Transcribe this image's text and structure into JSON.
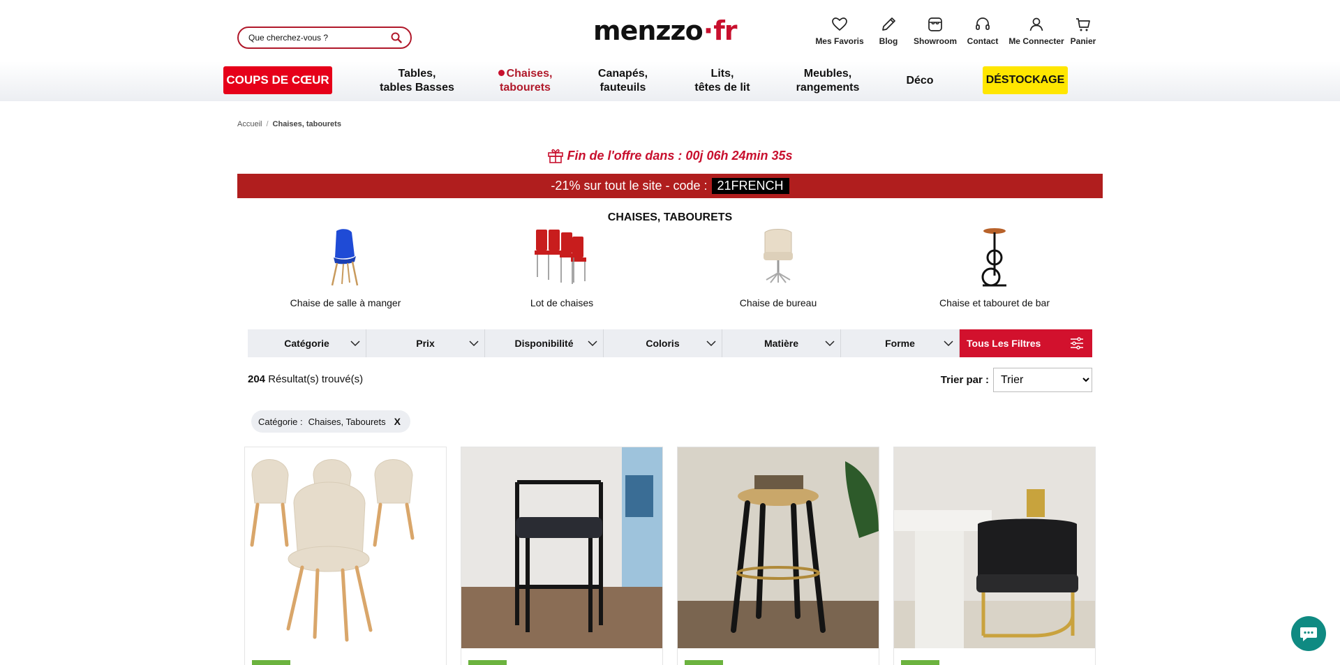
{
  "search": {
    "placeholder": "Que cherchez-vous ?"
  },
  "logo": {
    "part1": "menzzo",
    "dot": "·",
    "part2": "fr"
  },
  "header_icons": [
    {
      "icon": "heart-icon",
      "label": "Mes Favoris"
    },
    {
      "icon": "pencil-icon",
      "label": "Blog"
    },
    {
      "icon": "store-icon",
      "label": "Showroom"
    },
    {
      "icon": "headset-icon",
      "label": "Contact"
    },
    {
      "icon": "user-icon",
      "label": "Me Connecter"
    },
    {
      "icon": "cart-icon",
      "label": "Panier"
    }
  ],
  "nav": {
    "coups": "COUPS DE CŒUR",
    "tables": [
      "Tables,",
      "tables Basses"
    ],
    "chaises": [
      "Chaises,",
      "tabourets"
    ],
    "canapes": [
      "Canapés,",
      "fauteuils"
    ],
    "lits": [
      "Lits,",
      "têtes de lit"
    ],
    "meubles": [
      "Meubles,",
      "rangements"
    ],
    "deco": "Déco",
    "destockage": "DÉSTOCKAGE"
  },
  "breadcrumb": {
    "home": "Accueil",
    "sep": "/",
    "current": "Chaises, tabourets"
  },
  "offer": {
    "text": "Fin de l'offre dans : 00j 06h 24min 35s"
  },
  "promo": {
    "text": "-21% sur tout le site - code :",
    "code": "21FRENCH"
  },
  "category_title": "CHAISES, TABOURETS",
  "subcategories": [
    {
      "label": "Chaise de salle à manger"
    },
    {
      "label": "Lot de chaises"
    },
    {
      "label": "Chaise de bureau"
    },
    {
      "label": "Chaise et tabouret de bar"
    }
  ],
  "filters": [
    "Catégorie",
    "Prix",
    "Disponibilité",
    "Coloris",
    "Matière",
    "Forme"
  ],
  "filters_all": "Tous Les Filtres",
  "results": {
    "count": "204",
    "label": "Résultat(s) trouvé(s)"
  },
  "sort": {
    "label": "Trier par :",
    "selected": "Trier"
  },
  "active_filter": {
    "key": "Catégorie :",
    "value": "Chaises, Tabourets",
    "remove": "X"
  },
  "products": [
    {
      "alt": "Lot de chaises beige",
      "badge": ""
    },
    {
      "alt": "Tabouret de bar noir",
      "badge": ""
    },
    {
      "alt": "Tabouret bois noir",
      "badge": ""
    },
    {
      "alt": "Chaise noire et dorée",
      "badge": ""
    }
  ],
  "colors": {
    "brand_red": "#c8102e",
    "promo_red": "#b01e1e",
    "destock_yellow": "#ffe600",
    "filter_bg": "#eceef2",
    "chat_teal": "#0f8a82"
  }
}
